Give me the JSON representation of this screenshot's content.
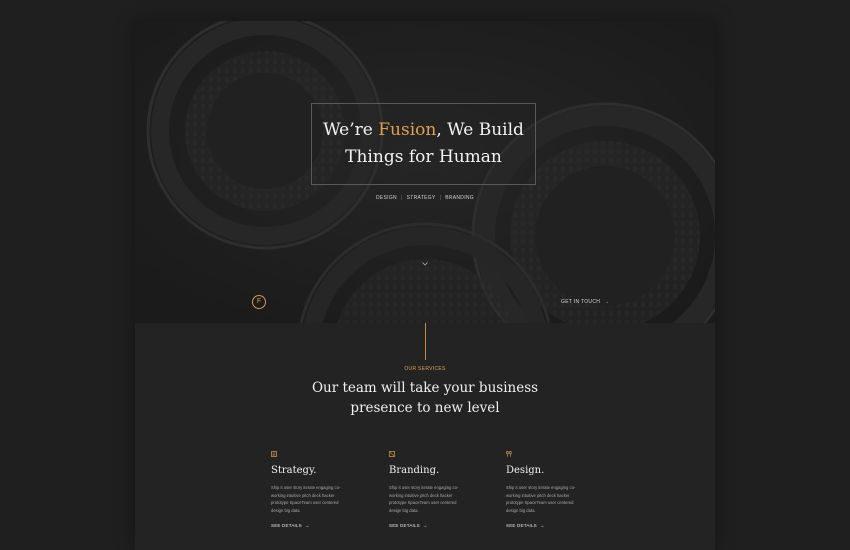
{
  "hero": {
    "title_line1_pre": "We’re ",
    "title_accent": "Fusion",
    "title_line1_post": ", We Build",
    "title_line2": "Things for Human",
    "tags": [
      "DESIGN",
      "STRATEGY",
      "BRANDING"
    ],
    "scroll_icon": "chevron-down",
    "logo_letter": "F",
    "cta_label": "GET IN TOUCH",
    "cta_arrow": "→"
  },
  "services": {
    "eyebrow": "OUR SERVICES",
    "title_line1": "Our team will take your business",
    "title_line2": "presence to new level",
    "items": [
      {
        "icon": "document-icon",
        "name": "Strategy.",
        "description": "Ship it user story iterate engaging co-working intuitive pitch deck hacker prototype SpaceTeam user centered design big data.",
        "link_label": "SEE DETAILS",
        "link_arrow": "→"
      },
      {
        "icon": "pen-square-icon",
        "name": "Branding.",
        "description": "Ship it user story iterate engaging co-working intuitive pitch deck hacker prototype SpaceTeam user centered design big data.",
        "link_label": "SEE DETAILS",
        "link_arrow": "→"
      },
      {
        "icon": "design-tools-icon",
        "name": "Design.",
        "description": "Ship it user story iterate engaging co-working intuitive pitch deck hacker prototype SpaceTeam user centered design big data.",
        "link_label": "SEE DETAILS",
        "link_arrow": "→"
      }
    ]
  },
  "colors": {
    "accent": "#e0a04e",
    "background": "#1f1f1f",
    "panel": "#232323"
  }
}
